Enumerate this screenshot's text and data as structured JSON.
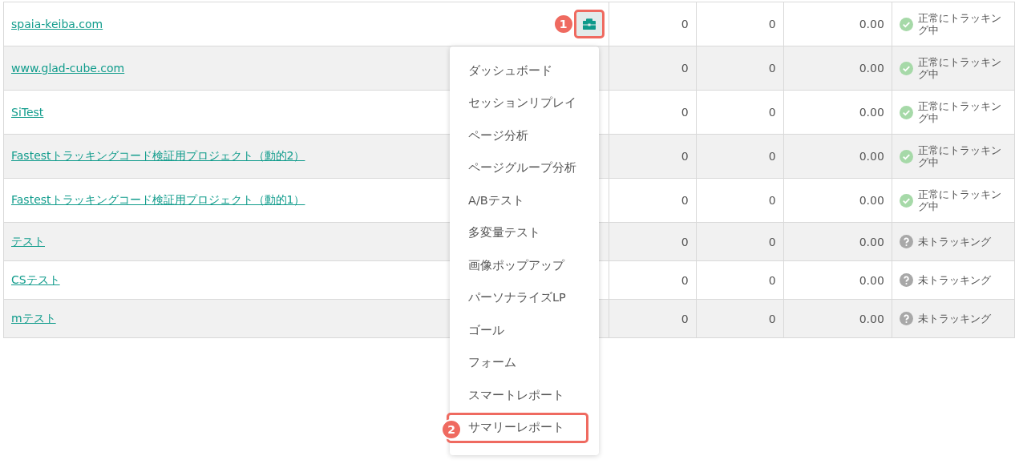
{
  "rows": [
    {
      "name": "spaia-keiba.com",
      "callout": "1",
      "col_2": "0",
      "col_3": "0",
      "col_4": "0.00",
      "status": {
        "kind": "tracking",
        "text": "正常にトラッキング中"
      }
    },
    {
      "name": "www.glad-cube.com",
      "col_2": "0",
      "col_3": "0",
      "col_4": "0.00",
      "status": {
        "kind": "tracking",
        "text": "正常にトラッキング中"
      }
    },
    {
      "name": "SiTest",
      "col_2": "0",
      "col_3": "0",
      "col_4": "0.00",
      "status": {
        "kind": "tracking",
        "text": "正常にトラッキング中"
      }
    },
    {
      "name": "Fastestトラッキングコード検証用プロジェクト（動的2）",
      "col_2": "0",
      "col_3": "0",
      "col_4": "0.00",
      "status": {
        "kind": "tracking",
        "text": "正常にトラッキング中"
      }
    },
    {
      "name": "Fastestトラッキングコード検証用プロジェクト（動的1）",
      "col_2": "0",
      "col_3": "0",
      "col_4": "0.00",
      "status": {
        "kind": "tracking",
        "text": "正常にトラッキング中"
      }
    },
    {
      "name": "テスト",
      "col_2": "0",
      "col_3": "0",
      "col_4": "0.00",
      "status": {
        "kind": "untracked",
        "text": "未トラッキング"
      }
    },
    {
      "name": "CSテスト",
      "col_2": "0",
      "col_3": "0",
      "col_4": "0.00",
      "status": {
        "kind": "untracked",
        "text": "未トラッキング"
      }
    },
    {
      "name": "mテスト",
      "col_2": "0",
      "col_3": "0",
      "col_4": "0.00",
      "status": {
        "kind": "untracked",
        "text": "未トラッキング"
      }
    }
  ],
  "menu": {
    "items": [
      {
        "label": "ダッシュボード"
      },
      {
        "label": "セッションリプレイ"
      },
      {
        "label": "ページ分析"
      },
      {
        "label": "ページグループ分析"
      },
      {
        "label": "A/Bテスト"
      },
      {
        "label": "多変量テスト"
      },
      {
        "label": "画像ポップアップ"
      },
      {
        "label": "パーソナライズLP"
      },
      {
        "label": "ゴール"
      },
      {
        "label": "フォーム"
      },
      {
        "label": "スマートレポート"
      },
      {
        "label": "サマリーレポート",
        "callout": "2"
      }
    ]
  }
}
